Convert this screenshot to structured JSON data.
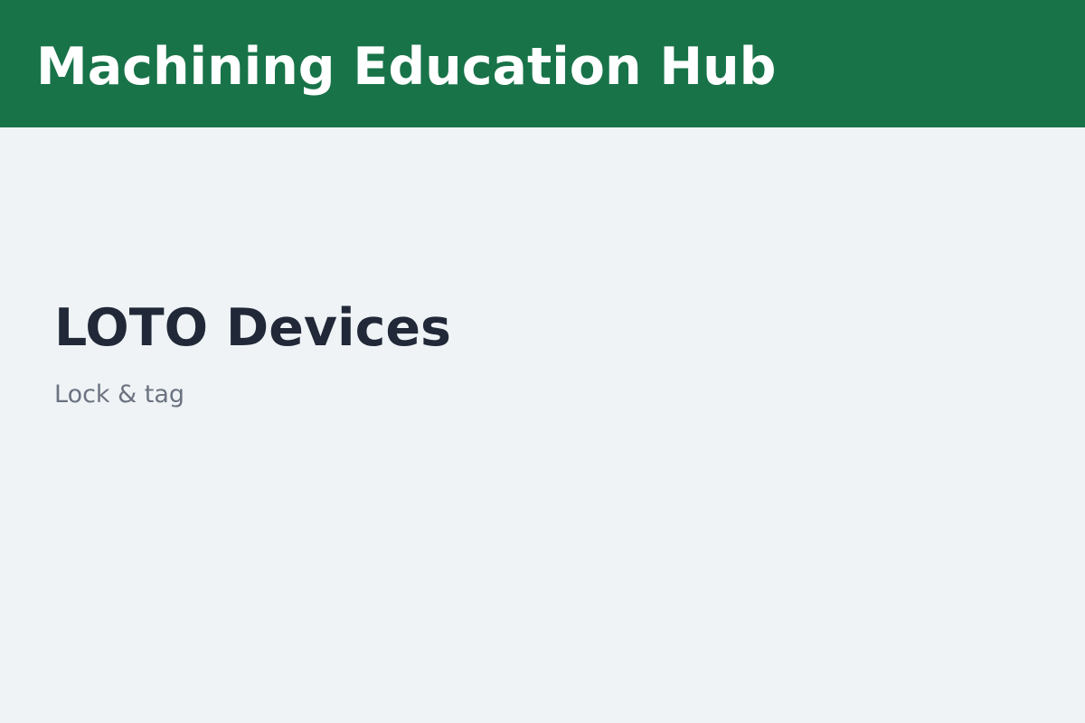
{
  "header": {
    "title": "Machining Education Hub"
  },
  "main": {
    "title": "LOTO Devices",
    "subtitle": "Lock & tag"
  },
  "colors": {
    "header_background": "#187349",
    "page_background": "#eff3f6",
    "title_text": "#212938",
    "subtitle_text": "#6b7280"
  }
}
